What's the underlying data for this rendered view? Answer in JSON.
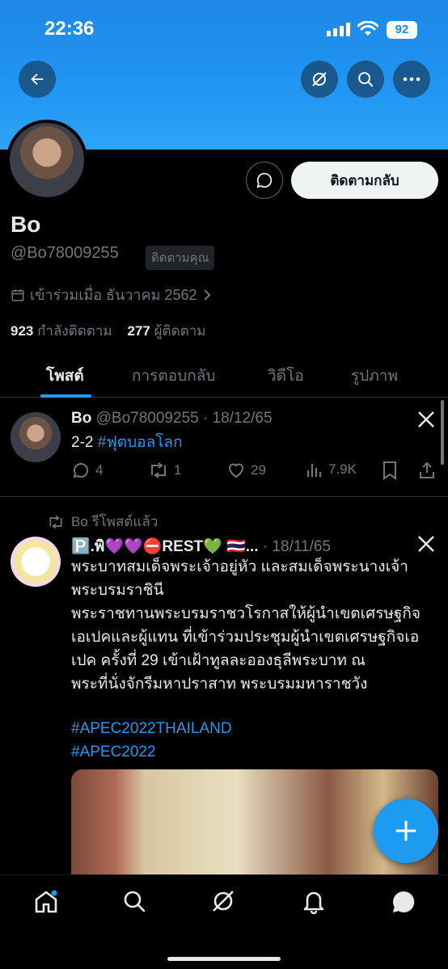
{
  "status_bar": {
    "time": "22:36",
    "battery": "92"
  },
  "profile": {
    "name": "Bo",
    "handle": "@Bo78009255",
    "follows_you": "ติดตามคุณ",
    "joined": "เข้าร่วมเมื่อ ธันวาคม 2562",
    "following_count": "923",
    "following_label": "กำลังติดตาม",
    "followers_count": "277",
    "followers_label": "ผู้ติดตาม",
    "follow_back_label": "ติดตามกลับ"
  },
  "tabs": [
    {
      "label": "โพสต์"
    },
    {
      "label": "การตอบกลับ"
    },
    {
      "label": "วิดีโอ"
    },
    {
      "label": "รูปภาพ"
    }
  ],
  "tweet1": {
    "name": "Bo",
    "handle": "@Bo78009255",
    "date": "· 18/12/65",
    "text_prefix": "2-2 ",
    "hashtag": "#ฟุตบอลโลก",
    "replies": "4",
    "retweets": "1",
    "likes": "29",
    "views": "7.9K"
  },
  "tweet2": {
    "retweet_label": "Bo รีโพสต์แล้ว",
    "name": "🅿️.พิ💜💜⛔REST💚 🇹🇭...",
    "date": "· 18/11/65",
    "line1": "พระบาทสมเด็จพระเจ้าอยู่หัว และสมเด็จพระนางเจ้า",
    "line2": "พระบรมราชินี",
    "line3": "พระราชทานพระบรมราชวโรกาสให้ผู้นำเขตเศรษฐกิจ",
    "line4": "เอเปคและผู้แทน ที่เข้าร่วมประชุมผู้นำเขตเศรษฐกิจเอ",
    "line5": "เปค ครั้งที่ 29 เข้าเฝ้าทูลละอองธุลีพระบาท ณ",
    "line6": "พระที่นั่งจักรีมหาปราสาท พระบรมมหาราชวัง",
    "hashtag1": "#APEC2022THAILAND",
    "hashtag2": "#APEC2022"
  },
  "colors": {
    "accent": "#1d9bf0",
    "banner": "#2196f3",
    "background": "#000000",
    "muted": "#71767b"
  }
}
